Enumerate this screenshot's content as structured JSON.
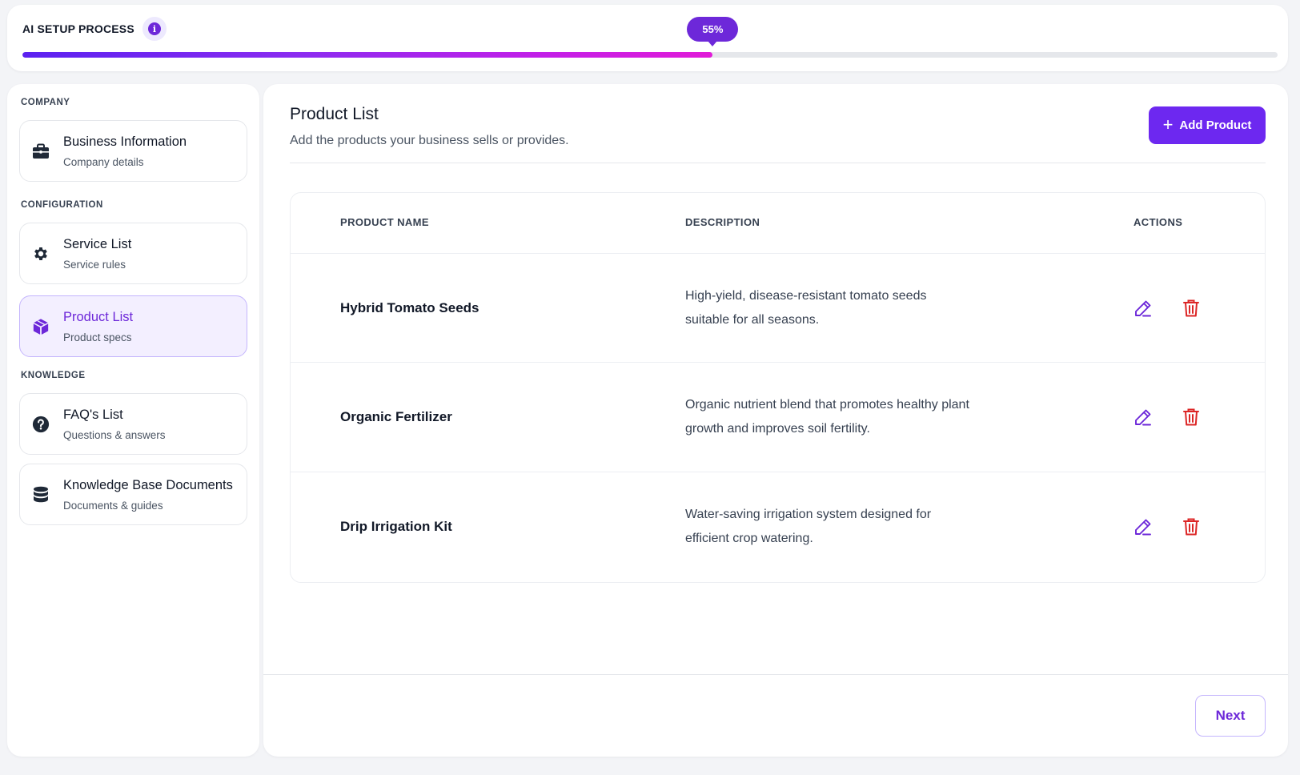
{
  "header": {
    "title": "AI SETUP PROCESS",
    "progress_label": "55%",
    "progress": 0.55
  },
  "sidebar": {
    "sections": [
      {
        "label": "COMPANY"
      },
      {
        "label": "CONFIGURATION"
      },
      {
        "label": "KNOWLEDGE"
      }
    ],
    "items": [
      {
        "title": "Business Information",
        "subtitle": "Company details",
        "icon": "briefcase-icon"
      },
      {
        "title": "Service List",
        "subtitle": "Service rules",
        "icon": "gear-icon"
      },
      {
        "title": "Product List",
        "subtitle": "Product specs",
        "icon": "cube-icon",
        "active": true
      },
      {
        "title": "FAQ's List",
        "subtitle": "Questions & answers",
        "icon": "question-circle-icon"
      },
      {
        "title": "Knowledge Base Documents",
        "subtitle": "Documents & guides",
        "icon": "database-icon"
      }
    ]
  },
  "main": {
    "title": "Product List",
    "subtitle": "Add the products your business sells or provides.",
    "add_button": "Add Product",
    "table": {
      "columns": [
        "PRODUCT NAME",
        "DESCRIPTION",
        "ACTIONS"
      ],
      "rows": [
        {
          "name": "Hybrid Tomato Seeds",
          "description": "High-yield, disease-resistant tomato seeds suitable for all seasons."
        },
        {
          "name": "Organic Fertilizer",
          "description": "Organic nutrient blend that promotes healthy plant growth and improves soil fertility."
        },
        {
          "name": "Drip Irrigation Kit",
          "description": "Water-saving irrigation system designed for efficient crop watering."
        }
      ]
    },
    "next_button": "Next"
  },
  "colors": {
    "accent": "#6d28d9",
    "danger": "#dc2626",
    "active_bg": "#f3efff"
  }
}
